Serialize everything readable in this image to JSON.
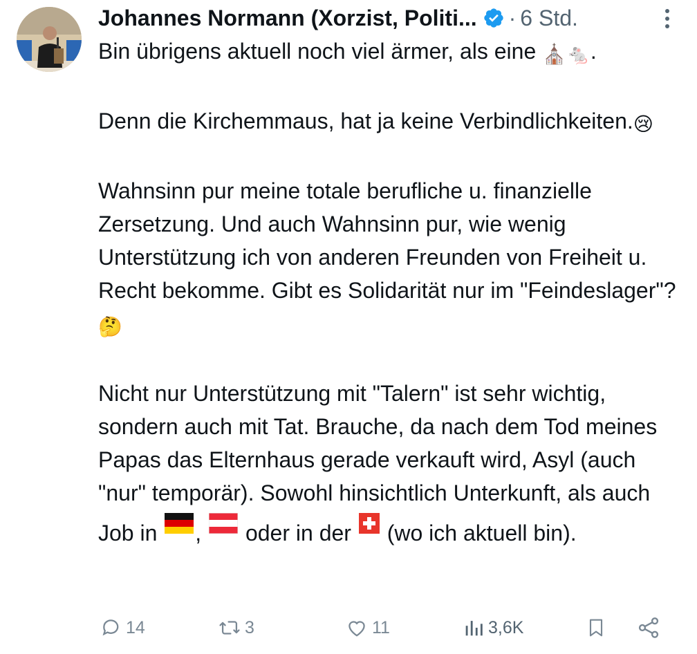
{
  "post": {
    "author_name": "Johannes Normann (Xorzist, Politi...",
    "separator": "·",
    "time_ago": "6 Std.",
    "paragraphs": {
      "p1": "Bin übrigens aktuell noch viel ärmer, als eine",
      "p1_emoji_church": "⛪",
      "p1_emoji_mouse": "🐁",
      "p1_end": ".",
      "p2": "Denn die Kirchemmaus, hat ja keine Verbindlichkeiten.",
      "p2_emoji": "😢",
      "p3": "Wahnsinn pur meine totale berufliche u. finanzielle Zersetzung. Und auch Wahnsinn pur, wie wenig Unterstützung ich von anderen Freunden von Freiheit u. Recht bekomme. Gibt es Solidarität nur im \"Feindeslager\"?",
      "p3_emoji": "🤔",
      "p4_a": "Nicht nur Unterstützung mit \"Talern\" ist sehr wichtig, sondern auch mit Tat. Brauche, da nach dem Tod meines Papas das Elternhaus gerade verkauft wird, Asyl (auch \"nur\" temporär). Sowohl hinsichtlich Unterkunft, als auch Job in",
      "p4_comma": ",",
      "p4_b": "oder in der",
      "p4_c": "(wo ich aktuell bin)."
    },
    "flags": [
      "germany-flag",
      "austria-flag",
      "switzerland-flag"
    ],
    "actions": {
      "replies": "14",
      "reposts": "3",
      "likes": "11",
      "views": "3,6K"
    },
    "colors": {
      "text": "#0f1419",
      "secondary": "#536471",
      "action_icons": "#7a8894",
      "verified": "#1d9bf0"
    }
  }
}
